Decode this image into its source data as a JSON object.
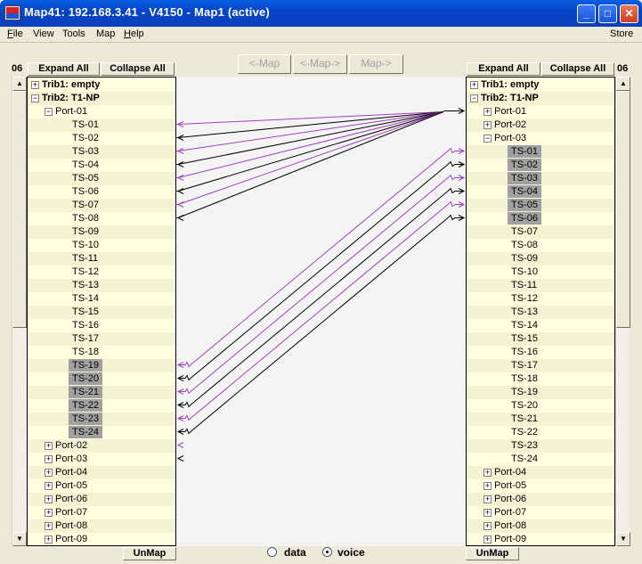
{
  "window": {
    "title": "Map41: 192.168.3.41  - V4150 - Map1 (active)",
    "minimize": "_",
    "maximize": "□",
    "close": "✕"
  },
  "menu": {
    "items": [
      {
        "label": "File",
        "u": "F",
        "rest": "ile"
      },
      {
        "label": "View",
        "u": "",
        "rest": "View"
      },
      {
        "label": "Tools",
        "u": "",
        "rest": "Tools"
      },
      {
        "label": "Map",
        "u": "",
        "rest": "Map"
      },
      {
        "label": "Help",
        "u": "H",
        "rest": "elp"
      }
    ],
    "store": "Store"
  },
  "left": {
    "number": "06",
    "expand_all": "Expand All",
    "collapse_all": "Collapse All",
    "unmap": "UnMap",
    "tree": [
      {
        "label": "Trib1: empty",
        "level": 0,
        "icon": "+",
        "bold": true
      },
      {
        "label": "Trib2: T1-NP",
        "level": 0,
        "icon": "-",
        "bold": true
      },
      {
        "label": "Port-01",
        "level": 1,
        "icon": "-"
      },
      {
        "label": "TS-01",
        "level": 2
      },
      {
        "label": "TS-02",
        "level": 2
      },
      {
        "label": "TS-03",
        "level": 2
      },
      {
        "label": "TS-04",
        "level": 2
      },
      {
        "label": "TS-05",
        "level": 2
      },
      {
        "label": "TS-06",
        "level": 2
      },
      {
        "label": "TS-07",
        "level": 2
      },
      {
        "label": "TS-08",
        "level": 2
      },
      {
        "label": "TS-09",
        "level": 2
      },
      {
        "label": "TS-10",
        "level": 2
      },
      {
        "label": "TS-11",
        "level": 2
      },
      {
        "label": "TS-12",
        "level": 2
      },
      {
        "label": "TS-13",
        "level": 2
      },
      {
        "label": "TS-14",
        "level": 2
      },
      {
        "label": "TS-15",
        "level": 2
      },
      {
        "label": "TS-16",
        "level": 2
      },
      {
        "label": "TS-17",
        "level": 2
      },
      {
        "label": "TS-18",
        "level": 2
      },
      {
        "label": "TS-19",
        "level": 2,
        "selected": true
      },
      {
        "label": "TS-20",
        "level": 2,
        "selected": true
      },
      {
        "label": "TS-21",
        "level": 2,
        "selected": true
      },
      {
        "label": "TS-22",
        "level": 2,
        "selected": true
      },
      {
        "label": "TS-23",
        "level": 2,
        "selected": true
      },
      {
        "label": "TS-24",
        "level": 2,
        "selected": true
      },
      {
        "label": "Port-02",
        "level": 1,
        "icon": "+"
      },
      {
        "label": "Port-03",
        "level": 1,
        "icon": "+"
      },
      {
        "label": "Port-04",
        "level": 1,
        "icon": "+"
      },
      {
        "label": "Port-05",
        "level": 1,
        "icon": "+"
      },
      {
        "label": "Port-06",
        "level": 1,
        "icon": "+"
      },
      {
        "label": "Port-07",
        "level": 1,
        "icon": "+"
      },
      {
        "label": "Port-08",
        "level": 1,
        "icon": "+"
      },
      {
        "label": "Port-09",
        "level": 1,
        "icon": "+"
      }
    ]
  },
  "right": {
    "number": "06",
    "expand_all": "Expand All",
    "collapse_all": "Collapse All",
    "unmap": "UnMap",
    "tree": [
      {
        "label": "Trib1: empty",
        "level": 0,
        "icon": "+",
        "bold": true
      },
      {
        "label": "Trib2: T1-NP",
        "level": 0,
        "icon": "-",
        "bold": true
      },
      {
        "label": "Port-01",
        "level": 1,
        "icon": "+"
      },
      {
        "label": "Port-02",
        "level": 1,
        "icon": "+"
      },
      {
        "label": "Port-03",
        "level": 1,
        "icon": "-"
      },
      {
        "label": "TS-01",
        "level": 2,
        "selected": true
      },
      {
        "label": "TS-02",
        "level": 2,
        "selected": true
      },
      {
        "label": "TS-03",
        "level": 2,
        "selected": true
      },
      {
        "label": "TS-04",
        "level": 2,
        "selected": true
      },
      {
        "label": "TS-05",
        "level": 2,
        "selected": true
      },
      {
        "label": "TS-06",
        "level": 2,
        "selected": true
      },
      {
        "label": "TS-07",
        "level": 2
      },
      {
        "label": "TS-08",
        "level": 2
      },
      {
        "label": "TS-09",
        "level": 2
      },
      {
        "label": "TS-10",
        "level": 2
      },
      {
        "label": "TS-11",
        "level": 2
      },
      {
        "label": "TS-12",
        "level": 2
      },
      {
        "label": "TS-13",
        "level": 2
      },
      {
        "label": "TS-14",
        "level": 2
      },
      {
        "label": "TS-15",
        "level": 2
      },
      {
        "label": "TS-16",
        "level": 2
      },
      {
        "label": "TS-17",
        "level": 2
      },
      {
        "label": "TS-18",
        "level": 2
      },
      {
        "label": "TS-19",
        "level": 2
      },
      {
        "label": "TS-20",
        "level": 2
      },
      {
        "label": "TS-21",
        "level": 2
      },
      {
        "label": "TS-22",
        "level": 2
      },
      {
        "label": "TS-23",
        "level": 2
      },
      {
        "label": "TS-24",
        "level": 2
      },
      {
        "label": "Port-04",
        "level": 1,
        "icon": "+"
      },
      {
        "label": "Port-05",
        "level": 1,
        "icon": "+"
      },
      {
        "label": "Port-06",
        "level": 1,
        "icon": "+"
      },
      {
        "label": "Port-07",
        "level": 1,
        "icon": "+"
      },
      {
        "label": "Port-08",
        "level": 1,
        "icon": "+"
      },
      {
        "label": "Port-09",
        "level": 1,
        "icon": "+"
      }
    ]
  },
  "map_buttons": {
    "map_left": "<-Map",
    "map_both": "<-Map->",
    "map_right": "Map->"
  },
  "mode": {
    "data_label": "data",
    "voice_label": "voice",
    "selected": "voice"
  },
  "colors": {
    "purple": "#a040c0",
    "black": "#000000",
    "selection": "#a0a0a0",
    "panel_bg": "#ffffe0"
  },
  "mappings": [
    {
      "left_row": 3,
      "right_row": 2,
      "color": "purple"
    },
    {
      "left_row": 4,
      "right_row": 2,
      "color": "black"
    },
    {
      "left_row": 5,
      "right_row": 2,
      "color": "purple"
    },
    {
      "left_row": 6,
      "right_row": 2,
      "color": "black"
    },
    {
      "left_row": 7,
      "right_row": 2,
      "color": "purple"
    },
    {
      "left_row": 8,
      "right_row": 2,
      "color": "black"
    },
    {
      "left_row": 9,
      "right_row": 2,
      "color": "purple"
    },
    {
      "left_row": 10,
      "right_row": 2,
      "color": "black"
    },
    {
      "left_row": 21,
      "right_row": 5,
      "color": "purple"
    },
    {
      "left_row": 22,
      "right_row": 6,
      "color": "black"
    },
    {
      "left_row": 23,
      "right_row": 7,
      "color": "purple"
    },
    {
      "left_row": 24,
      "right_row": 8,
      "color": "black"
    },
    {
      "left_row": 25,
      "right_row": 9,
      "color": "purple"
    },
    {
      "left_row": 26,
      "right_row": 10,
      "color": "black"
    }
  ],
  "stubs": [
    {
      "row": 27,
      "color": "purple"
    },
    {
      "row": 28,
      "color": "black"
    }
  ]
}
